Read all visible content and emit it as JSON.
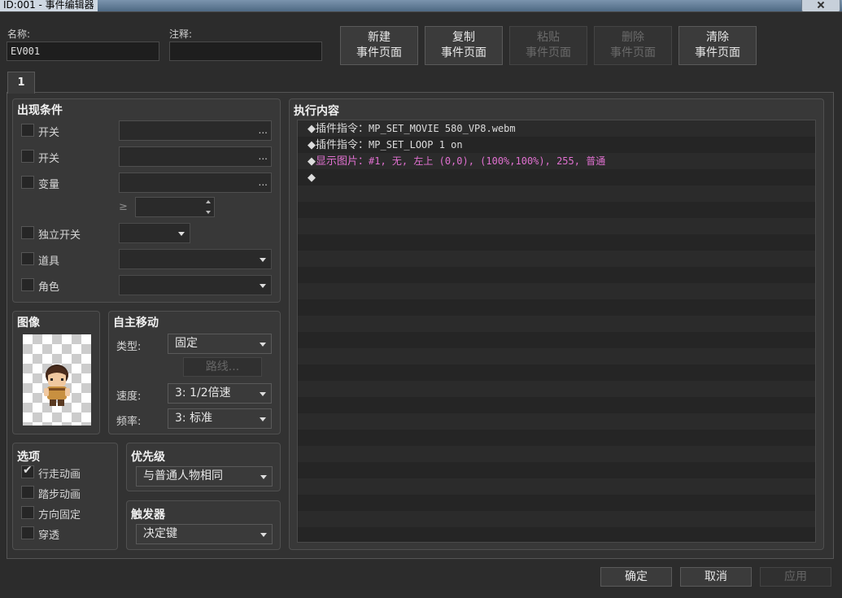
{
  "window": {
    "title": "ID:001 - 事件编辑器"
  },
  "header": {
    "name_label": "名称:",
    "name_value": "EV001",
    "note_label": "注释:",
    "note_value": "",
    "buttons": [
      {
        "line1": "新建",
        "line2": "事件页面",
        "enabled": true
      },
      {
        "line1": "复制",
        "line2": "事件页面",
        "enabled": true
      },
      {
        "line1": "粘贴",
        "line2": "事件页面",
        "enabled": false
      },
      {
        "line1": "删除",
        "line2": "事件页面",
        "enabled": false
      },
      {
        "line1": "清除",
        "line2": "事件页面",
        "enabled": true
      }
    ]
  },
  "tabs": [
    "1"
  ],
  "conditions": {
    "title": "出现条件",
    "switch1": "开关",
    "switch2": "开关",
    "variable": "变量",
    "ge_symbol": "≥",
    "self_switch": "独立开关",
    "item": "道具",
    "actor": "角色",
    "dots": "..."
  },
  "image": {
    "title": "图像"
  },
  "autonomous": {
    "title": "自主移动",
    "type_label": "类型:",
    "type_value": "固定",
    "route_button": "路线...",
    "speed_label": "速度:",
    "speed_value": "3: 1/2倍速",
    "freq_label": "频率:",
    "freq_value": "3: 标准"
  },
  "options": {
    "title": "选项",
    "items": [
      {
        "label": "行走动画",
        "checked": true
      },
      {
        "label": "踏步动画",
        "checked": false
      },
      {
        "label": "方向固定",
        "checked": false
      },
      {
        "label": "穿透",
        "checked": false
      }
    ]
  },
  "priority": {
    "title": "优先级",
    "value": "与普通人物相同"
  },
  "trigger": {
    "title": "触发器",
    "value": "决定键"
  },
  "contents": {
    "title": "执行内容",
    "commands": [
      {
        "marker": "◆",
        "head": "插件指令：",
        "body": "MP_SET_MOVIE 580_VP8.webm"
      },
      {
        "marker": "◆",
        "head": "插件指令：",
        "body": "MP_SET_LOOP 1 on"
      },
      {
        "marker": "◆",
        "head": "显示图片：",
        "body": "#1, 无, 左上 (0,0), (100%,100%), 255, 普通"
      },
      {
        "marker": "◆",
        "head": "",
        "body": ""
      }
    ]
  },
  "footer": {
    "ok": "确定",
    "cancel": "取消",
    "apply": "应用"
  },
  "colors": {
    "picture_command": "#e070d0",
    "background": "#2c2c2c"
  }
}
